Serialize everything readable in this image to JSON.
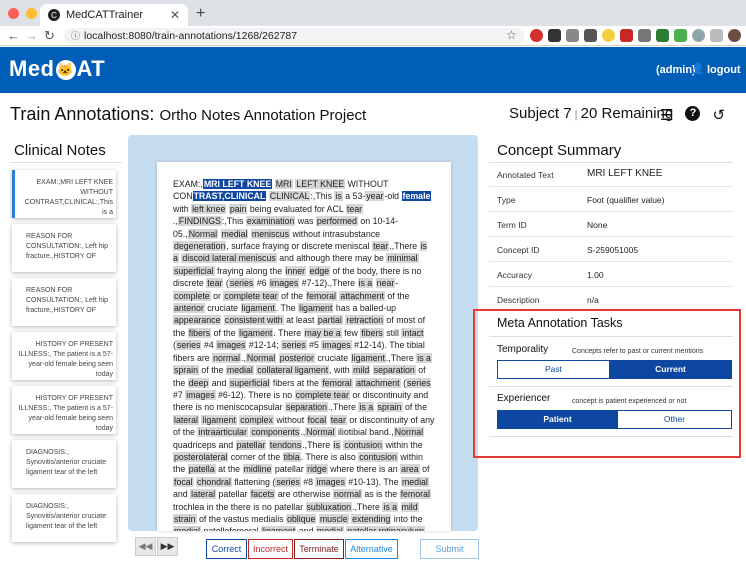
{
  "browser": {
    "tab_title": "MedCATTrainer",
    "url": "localhost:8080/train-annotations/1268/262787"
  },
  "header": {
    "logo_left": "Med",
    "logo_right": "AT",
    "user": "(admin)",
    "logout": "logout"
  },
  "title": {
    "label": "Train Annotations:",
    "project": "Ortho Notes Annotation Project",
    "subject": "Subject 7",
    "remaining": "20 Remaining"
  },
  "clinical_notes": {
    "heading": "Clinical Notes",
    "items": [
      "EXAM:,MRI LEFT KNEE WITHOUT CONTRAST,CLINICAL:,This is a",
      "REASON FOR CONSULTATION:, Left hip fracture.,HISTORY OF",
      "REASON FOR CONSULTATION:, Left hip fracture.,HISTORY OF",
      "HISTORY OF PRESENT ILLNESS:, The patient is a 57-year-old female being seen today",
      "HISTORY OF PRESENT ILLNESS:, The patient is a 57-year-old female being seen today",
      "DIAGNOSIS:, Synovitis/anterior cruciate ligament tear of the left",
      "DIAGNOSIS:, Synovitis/anterior cruciate ligament tear of the left"
    ]
  },
  "buttons": {
    "correct": "Correct",
    "incorrect": "Incorrect",
    "terminate": "Terminate",
    "alternative": "Alternative",
    "submit": "Submit"
  },
  "concept_summary": {
    "heading": "Concept Summary",
    "rows": [
      {
        "key": "Annotated Text",
        "value": "MRI LEFT KNEE"
      },
      {
        "key": "Type",
        "value": "Foot (qualifier value)"
      },
      {
        "key": "Term ID",
        "value": "None"
      },
      {
        "key": "Concept ID",
        "value": "S-259051005"
      },
      {
        "key": "Accuracy",
        "value": "1.00"
      },
      {
        "key": "Description",
        "value": "n/a"
      }
    ]
  },
  "meta": {
    "heading": "Meta Annotation Tasks",
    "tasks": [
      {
        "name": "Temporality",
        "desc": "Concepts refer to past or current mentions",
        "options": [
          "Past",
          "Current"
        ],
        "selected": "Current"
      },
      {
        "name": "Experiencer",
        "desc": "concept is patient experienced or not",
        "options": [
          "Patient",
          "Other"
        ],
        "selected": "Patient"
      }
    ]
  },
  "colors": {
    "brand": "#005EB8",
    "selected": "#0d47a1",
    "highlight": "#e53935"
  },
  "icons": {
    "list": "list-icon",
    "help": "help-icon",
    "reset": "undo-icon",
    "user": "user-icon"
  }
}
